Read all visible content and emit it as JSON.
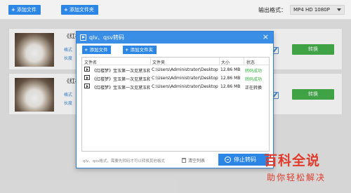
{
  "toolbar": {
    "add_file": "添加文件",
    "add_folder": "添加文件夹",
    "format_label": "输出格式：",
    "format_value": "MP4  HD 1080P"
  },
  "rows": [
    {
      "title": "《红楼",
      "meta_format": "格式",
      "meta_length": "长度",
      "convert_label": "转换"
    },
    {
      "title": "《红楼",
      "meta_format": "格式",
      "meta_length": "长度",
      "convert_label": "转换"
    }
  ],
  "dialog": {
    "title": "qlv、qsv转码",
    "close": "×",
    "add_file": "添加文件",
    "add_folder": "添加文件夹",
    "columns": [
      "文件名",
      "文件夹",
      "大小",
      "状态"
    ],
    "files": [
      {
        "name": "《红楼梦》宝玉第一次见黛玉和",
        "dir": "C:\\Users\\Administrator\\Desktop",
        "size": "12.86 MB",
        "status": "转码成功",
        "state": "ok"
      },
      {
        "name": "《红楼梦》宝玉第一次见黛玉和",
        "dir": "C:\\Users\\Administrator\\Desktop",
        "size": "12.86 MB",
        "status": "转码成功",
        "state": "ok"
      },
      {
        "name": "《红楼梦》宝玉第一次见黛玉和",
        "dir": "C:\\Users\\Administrator\\Desktop",
        "size": "12.86 MB",
        "status": "正在转换",
        "state": "doing"
      }
    ],
    "footer_note": "qlv、qsv格式，需要先转码才可以转换其他格式",
    "clear_list": "清空列表",
    "stop_label": "停止转码"
  },
  "watermark": {
    "main": "百科全说",
    "sub": "助你轻松解决"
  },
  "colors": {
    "accent": "#2b86e6",
    "success": "#45b04a",
    "watermark": "#e23a2a"
  }
}
